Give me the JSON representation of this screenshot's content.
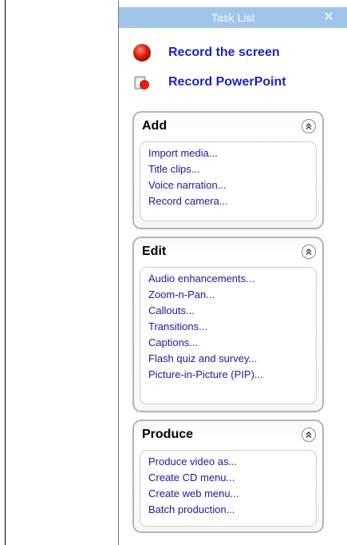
{
  "task_pane": {
    "title": "Task List",
    "close_glyph": "✕",
    "title_bar_color": "#9fc5eb",
    "link_color": "#1f1fc8",
    "item_color": "#1a1a99"
  },
  "record_links": [
    {
      "label": "Record the screen",
      "icon": "red-dot-icon"
    },
    {
      "label": "Record PowerPoint",
      "icon": "powerpoint-record-icon"
    }
  ],
  "groups": [
    {
      "title": "Add",
      "items": [
        "Import media...",
        "Title clips...",
        "Voice narration...",
        "Record camera..."
      ]
    },
    {
      "title": "Edit",
      "items": [
        "Audio enhancements...",
        "Zoom-n-Pan...",
        "Callouts...",
        "Transitions...",
        "Captions...",
        "Flash quiz and survey...",
        "Picture-in-Picture (PIP)..."
      ]
    },
    {
      "title": "Produce",
      "items": [
        "Produce video as...",
        "Create CD menu...",
        "Create web menu...",
        "Batch production..."
      ]
    }
  ]
}
